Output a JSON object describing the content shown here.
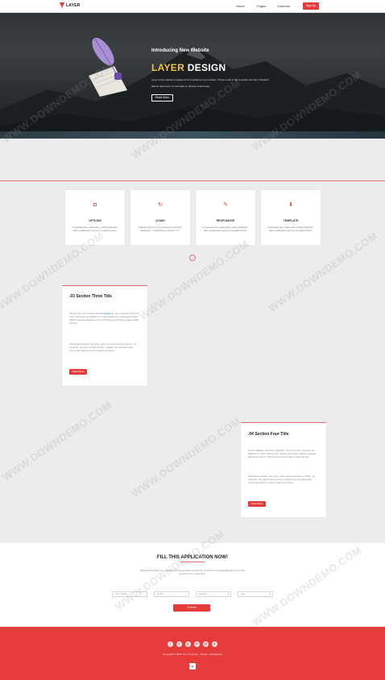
{
  "nav": {
    "brand": "LAYER",
    "links": [
      "Home",
      "Pages",
      "Columns"
    ],
    "signup": "Sign Up"
  },
  "hero": {
    "kicker": "Introducing New Website",
    "title_accent": "LAYER",
    "title_rest": " DESIGN",
    "line1": "Layer is free website template from templatemo.com website. Photos used in this template are from Unsplash.",
    "line2": "Mauris eget lacus. Ut sed tellus et ultricies scelerisque.",
    "button": "Read More"
  },
  "features": [
    {
      "icon": "camera-icon",
      "glyph": "◘",
      "title": "OPTIONS",
      "text": "In egestas arcu vitae diam mollis dignissim. Nam vestibulum sed eros feugiat tempor."
    },
    {
      "icon": "refresh-icon",
      "glyph": "↻",
      "title": "ICONS",
      "text": "Change icons by Font Awesome website. Example: <i class=fa fa-refresh></i>"
    },
    {
      "icon": "pencil-icon",
      "glyph": "✎",
      "title": "RESPONSIVE",
      "text": "In egestas arcu vitae diam mollis dignissim. Nam vestibulum sed eros feugiat tempor."
    },
    {
      "icon": "download-icon",
      "glyph": "⬇",
      "title": "TEMPLATE",
      "text": "In egestas arcu vitae diam mollis dignissim. Nam vestibulum sed eros feugiat tempor."
    }
  ],
  "section3": {
    "title": ".03 Section Three Title",
    "p1_a": "Please tell your friends about ",
    "p1_link": "templatemo",
    "p1_b": " .com website. Ut sit mi nunc. Praesent ac efficitur mi. Pellentesque ut mauris accumsan. Mauris egestas dignissim eros ut finibus sed turpis in diam mollis lobortis.",
    "p2": "Phasellus tincidunt nec ante, quis commodo luctus pretium. Ut molestie, est eget feugiat tempor, magna nisi volutpat ligula, commodo efficitur metus magna vel ipsum.",
    "button": "Read More"
  },
  "section4": {
    "title": ".04 Section Four Title",
    "p1": "Donec aliquam tincidunt vulputate. Ut sit mi nunc. Praesent ac efficitur mi. Nam ullamcorper mauris accumsan. Mauris egestas dignissim eros ut finibus sed turpis in diam mollis lobortis.",
    "p2": "Phasellus tincidunt nec ante, quis commodo luctus pretium. Ut molestie, est eget feugiat tempor, magna nisi volutpat ligula, commodo efficitur metus magna vel ipsum.",
    "button": "Read More"
  },
  "form": {
    "title": "FILL THIS APPLICATION NOW!",
    "desc": "Nulla blandit felis nec, volutpat consequat tellus pretium ac. Interdum et malesuada fames ac ante ipsum primis in faucibus.",
    "name_placeholder": "Your Name",
    "email_placeholder": "Email",
    "select1": "Gender",
    "select2": "Age",
    "submit": "Submit"
  },
  "footer": {
    "social": [
      "f",
      "t",
      "g",
      "in",
      "yt",
      "p"
    ],
    "text": "Copyright © 2016 Your Company · Design: Templatemo",
    "to_top": "▲"
  },
  "watermark": "WWW.DOWNDEMO.COM"
}
